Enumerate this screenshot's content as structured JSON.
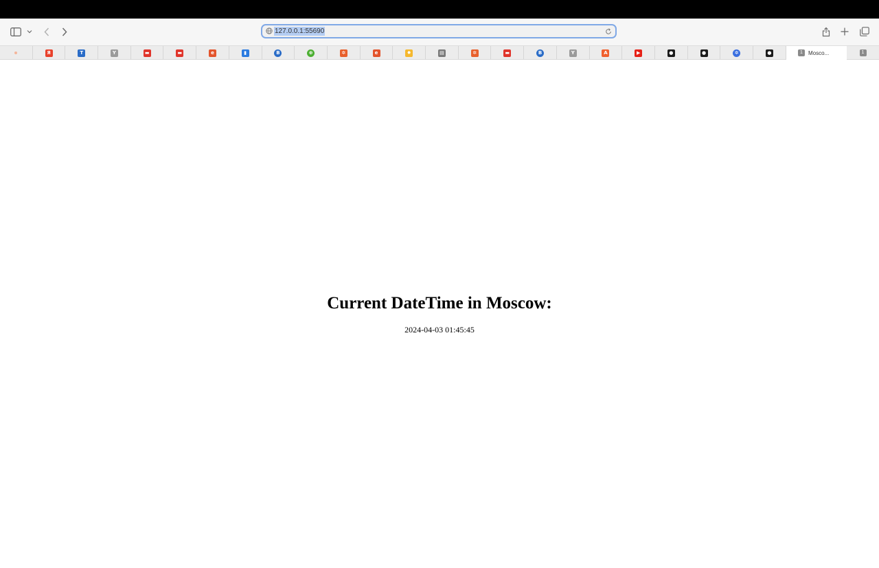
{
  "browser": {
    "url": "127.0.0.1:55690",
    "active_tab": {
      "badge": "1",
      "label": "Mosco..."
    },
    "extra_tab_badge": "1"
  },
  "favorites": [
    {
      "icon": "dot-icon",
      "glyph": "",
      "color": "#f4b59a"
    },
    {
      "icon": "yandex-icon",
      "glyph": "Я",
      "color": "#e8412b"
    },
    {
      "icon": "t-logo-icon",
      "glyph": "T",
      "color": "#2a6cc7"
    },
    {
      "icon": "y-logo-icon",
      "glyph": "Y",
      "color": "#9b9b9b"
    },
    {
      "icon": "car-icon",
      "glyph": "▬",
      "color": "#e0352b"
    },
    {
      "icon": "car-icon",
      "glyph": "▬",
      "color": "#e0352b"
    },
    {
      "icon": "e-logo-icon",
      "glyph": "e",
      "color": "#e3542c"
    },
    {
      "icon": "book-icon",
      "glyph": "▮",
      "color": "#2b7be0"
    },
    {
      "icon": "b-logo-icon",
      "glyph": "B",
      "color": "#2a6cc7"
    },
    {
      "icon": "globe-icon",
      "glyph": "⊕",
      "color": "#4caf32"
    },
    {
      "icon": "gear-icon",
      "glyph": "✲",
      "color": "#e8602c"
    },
    {
      "icon": "e-logo-icon",
      "glyph": "e",
      "color": "#e3542c"
    },
    {
      "icon": "sun-icon",
      "glyph": "✸",
      "color": "#f5b82e"
    },
    {
      "icon": "document-icon",
      "glyph": "▤",
      "color": "#7a7a7a"
    },
    {
      "icon": "gear-icon",
      "glyph": "✲",
      "color": "#e8602c"
    },
    {
      "icon": "car-icon",
      "glyph": "▬",
      "color": "#e0352b"
    },
    {
      "icon": "b-logo-icon",
      "glyph": "B",
      "color": "#2a6cc7"
    },
    {
      "icon": "y-logo-icon",
      "glyph": "Y",
      "color": "#9b9b9b"
    },
    {
      "icon": "a-logo-icon",
      "glyph": "A",
      "color": "#f0602e"
    },
    {
      "icon": "youtube-icon",
      "glyph": "▶",
      "color": "#e62117"
    },
    {
      "icon": "github-icon",
      "glyph": "●",
      "color": "#1b1b1b"
    },
    {
      "icon": "github-icon",
      "glyph": "●",
      "color": "#1b1b1b"
    },
    {
      "icon": "kubernetes-icon",
      "glyph": "✲",
      "color": "#3a6fe0"
    },
    {
      "icon": "github-icon",
      "glyph": "●",
      "color": "#1b1b1b"
    }
  ],
  "page": {
    "heading": "Current DateTime in Moscow:",
    "datetime": "2024-04-03 01:45:45"
  }
}
